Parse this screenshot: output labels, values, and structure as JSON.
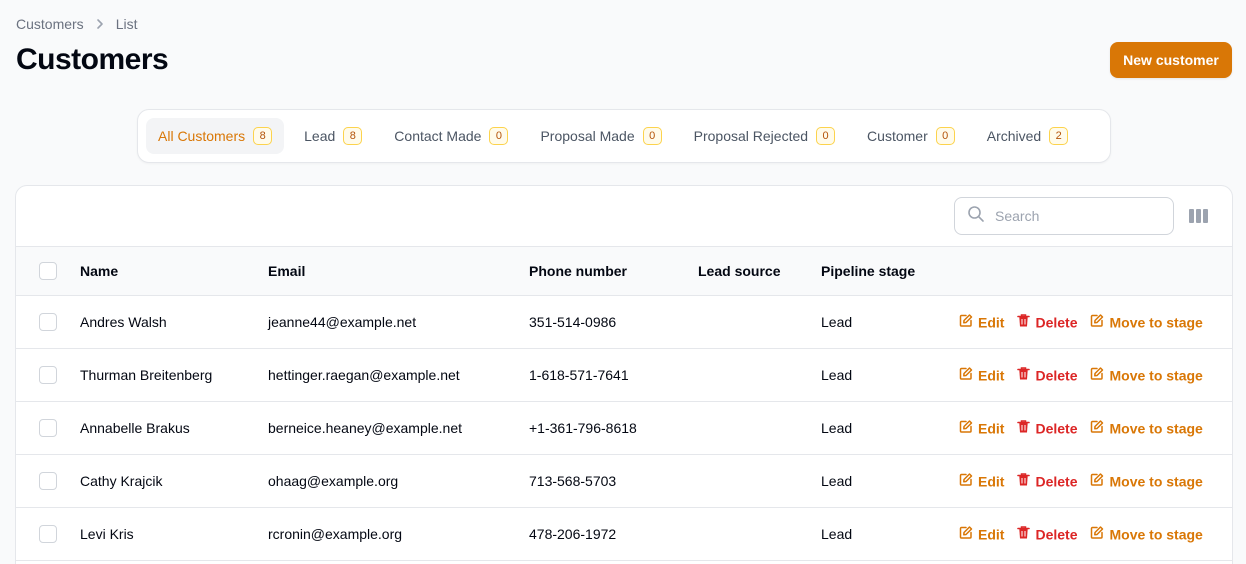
{
  "breadcrumb": {
    "items": [
      "Customers",
      "List"
    ]
  },
  "header": {
    "title": "Customers",
    "new_button": "New customer"
  },
  "tabs": [
    {
      "label": "All Customers",
      "count": "8"
    },
    {
      "label": "Lead",
      "count": "8"
    },
    {
      "label": "Contact Made",
      "count": "0"
    },
    {
      "label": "Proposal Made",
      "count": "0"
    },
    {
      "label": "Proposal Rejected",
      "count": "0"
    },
    {
      "label": "Customer",
      "count": "0"
    },
    {
      "label": "Archived",
      "count": "2"
    }
  ],
  "search": {
    "placeholder": "Search"
  },
  "table": {
    "columns": {
      "name": "Name",
      "email": "Email",
      "phone": "Phone number",
      "source": "Lead source",
      "stage": "Pipeline stage"
    },
    "actions": {
      "edit": "Edit",
      "delete": "Delete",
      "move": "Move to stage"
    },
    "rows": [
      {
        "name": "Andres Walsh",
        "email": "jeanne44@example.net",
        "phone": "351-514-0986",
        "source": "",
        "stage": "Lead"
      },
      {
        "name": "Thurman Breitenberg",
        "email": "hettinger.raegan@example.net",
        "phone": "1-618-571-7641",
        "source": "",
        "stage": "Lead"
      },
      {
        "name": "Annabelle Brakus",
        "email": "berneice.heaney@example.net",
        "phone": "+1-361-796-8618",
        "source": "",
        "stage": "Lead"
      },
      {
        "name": "Cathy Krajcik",
        "email": "ohaag@example.org",
        "phone": "713-568-5703",
        "source": "",
        "stage": "Lead"
      },
      {
        "name": "Levi Kris",
        "email": "rcronin@example.org",
        "phone": "478-206-1972",
        "source": "",
        "stage": "Lead"
      }
    ]
  },
  "colors": {
    "accent": "#d97706",
    "danger": "#dc2626"
  }
}
